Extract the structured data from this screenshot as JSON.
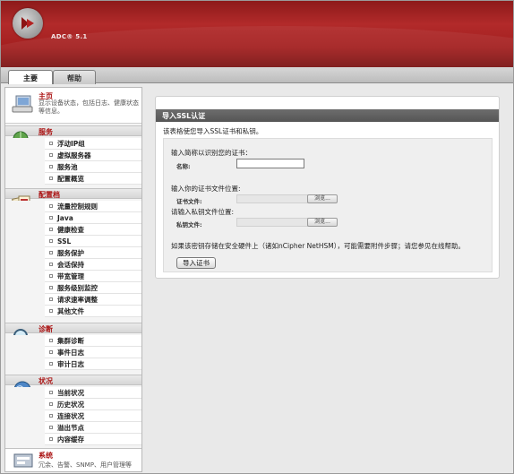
{
  "app": {
    "logo_text": "ADC® 5.1"
  },
  "tabs": [
    {
      "label": "主要"
    },
    {
      "label": "帮助"
    }
  ],
  "sidebar": {
    "home": {
      "title": "主页",
      "desc": "显示设备状态，包括日志、健康状态等信息。"
    },
    "services": {
      "title": "服务",
      "items": [
        "浮动IP组",
        "虚拟服务器",
        "服务池",
        "配置概览"
      ]
    },
    "catalog": {
      "title": "配置档",
      "items": [
        "流量控制规则",
        "Java",
        "健康检查",
        "SSL",
        "服务保护",
        "会话保持",
        "带宽管理",
        "服务级别监控",
        "请求速率调整",
        "其他文件"
      ]
    },
    "diagnose": {
      "title": "诊断",
      "items": [
        "集群诊断",
        "事件日志",
        "审计日志"
      ]
    },
    "activity": {
      "title": "状况",
      "items": [
        "当前状况",
        "历史状况",
        "连接状况",
        "溢出节点",
        "内容缓存"
      ]
    },
    "system": {
      "title": "系统",
      "desc": "冗余、告警、SNMP、用户管理等"
    }
  },
  "panel": {
    "title": "导入SSL认证",
    "intro": "该表格使您导入SSL证书和私钥。",
    "name_prompt": "输入简称以识别您的证书：",
    "name_label": "名称:",
    "name_value": "",
    "cert_prompt": "输入你的证书文件位置:",
    "cert_label": "证书文件:",
    "key_prompt": "请输入私钥文件位置:",
    "key_label": "私钥文件:",
    "browse_label": "浏览...",
    "hsm_note": "如果该密钥存储在安全硬件上（诸如nCipher NetHSM），可能需要附件步骤；请您参见在线帮助。",
    "import_button": "导入证书"
  }
}
